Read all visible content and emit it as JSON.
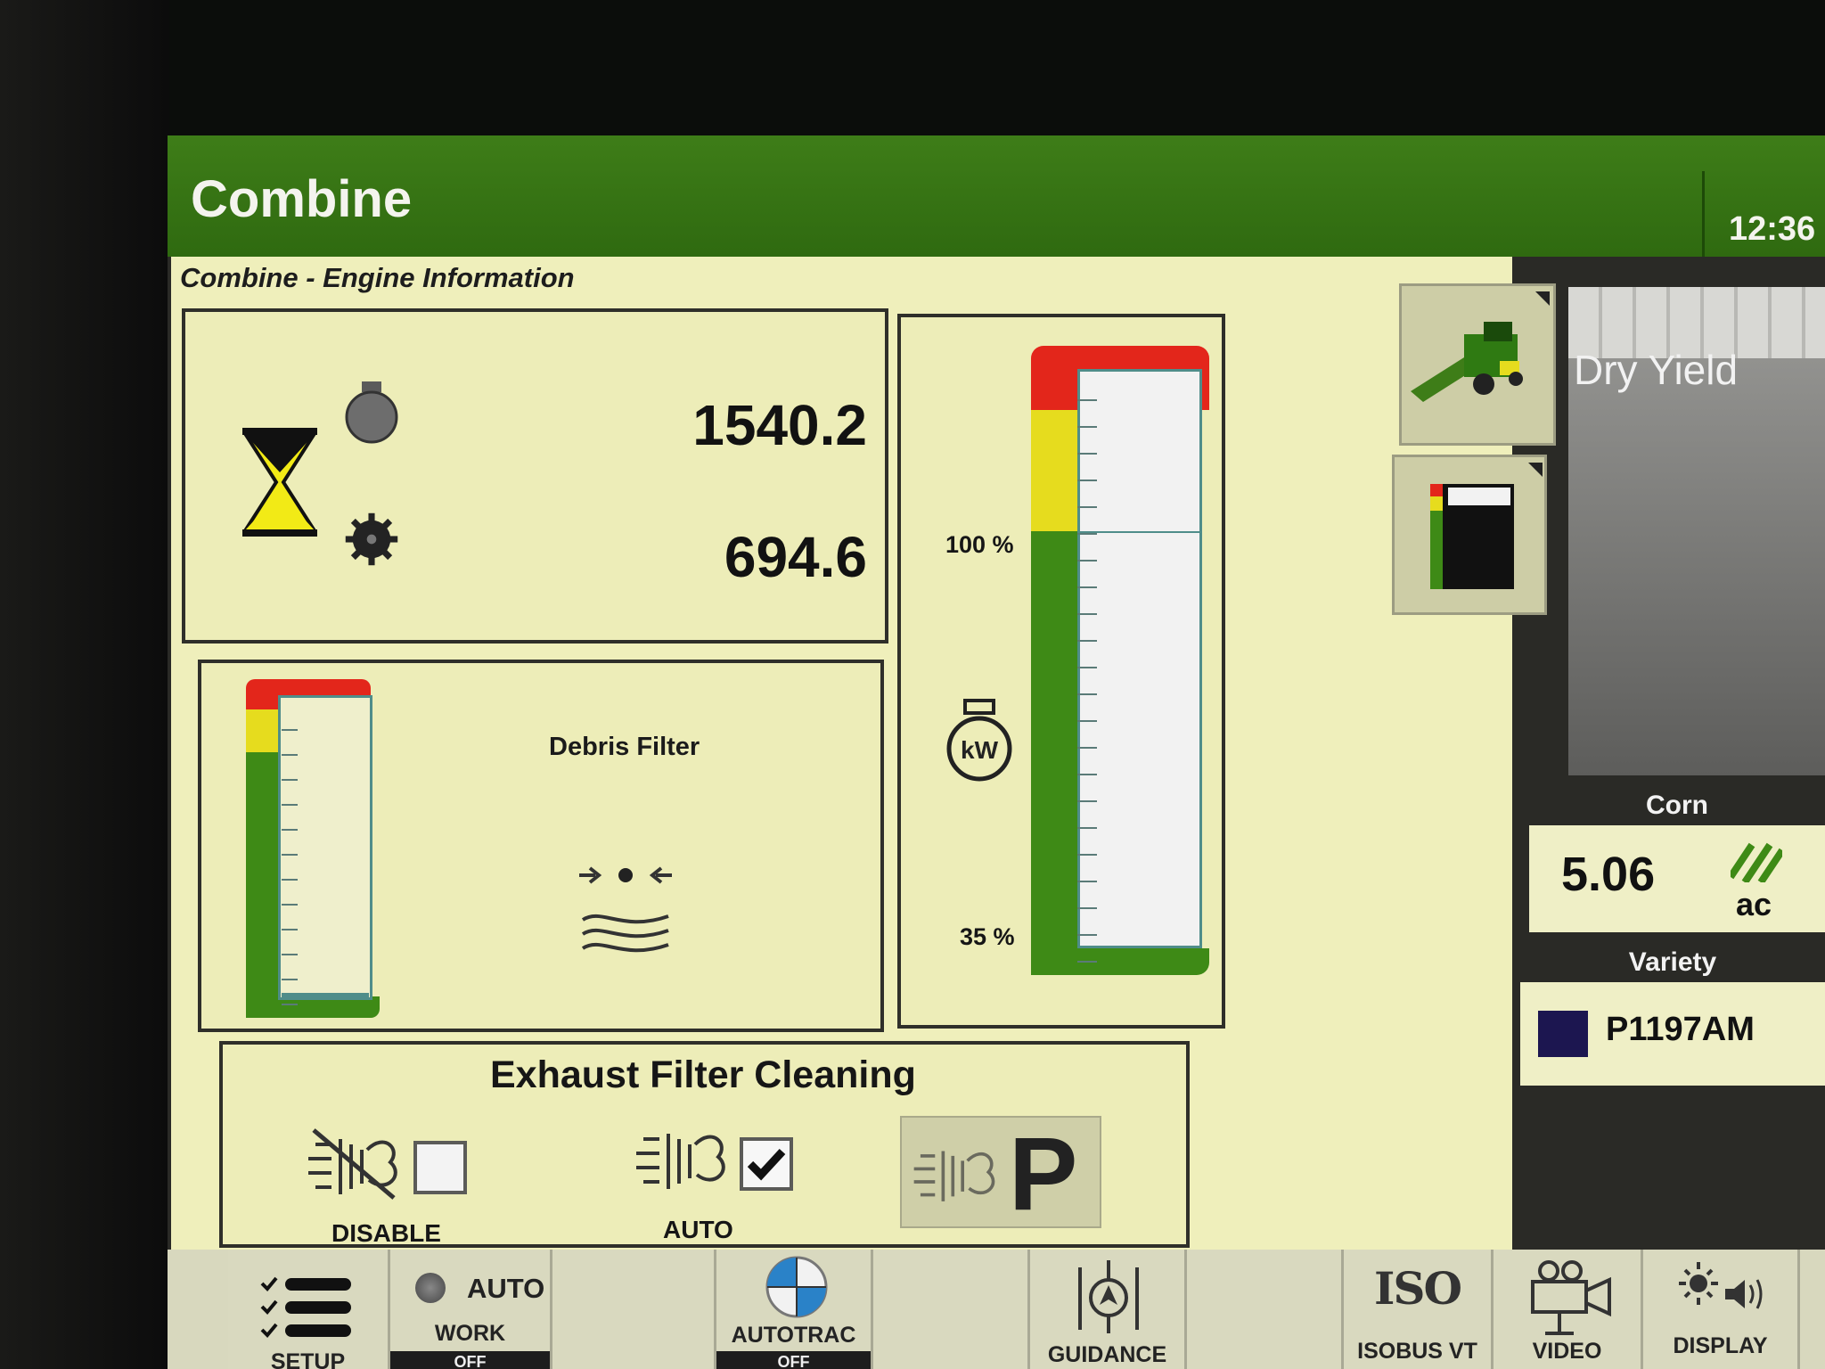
{
  "header": {
    "title": "Combine",
    "clock": "12:36"
  },
  "page": {
    "subtitle": "Combine - Engine Information"
  },
  "engine_hours": {
    "engine_hours_value": "1540.2",
    "separator_hours_value": "694.6"
  },
  "engine_power": {
    "upper_label": "100 %",
    "lower_label": "35 %",
    "unit_icon_text": "kW"
  },
  "debris_filter": {
    "label": "Debris Filter"
  },
  "exhaust": {
    "title": "Exhaust Filter Cleaning",
    "disable_label": "DISABLE",
    "disable_checked": false,
    "auto_label": "AUTO",
    "auto_checked": true,
    "park_label": "P"
  },
  "side_panel": {
    "dry_yield_title": "Dry Yield",
    "crop": {
      "name": "Corn",
      "area_value": "5.06",
      "area_unit": "ac"
    },
    "variety": {
      "header": "Variety",
      "name": "P1197AM"
    }
  },
  "toolbar": {
    "setup": "SETUP",
    "work": {
      "state": "AUTO",
      "label": "WORK",
      "status": "OFF"
    },
    "autotrac": {
      "label": "AUTOTRAC",
      "status": "OFF"
    },
    "guidance": "GUIDANCE",
    "isobus": {
      "logo": "ISO",
      "label": "ISOBUS VT"
    },
    "video": "VIDEO",
    "display": "DISPLAY"
  },
  "colors": {
    "header_green": "#367316",
    "cream": "#efefbb",
    "gauge_green": "#3e8a16",
    "gauge_yellow": "#e6dc1e",
    "gauge_red": "#e3261b"
  }
}
